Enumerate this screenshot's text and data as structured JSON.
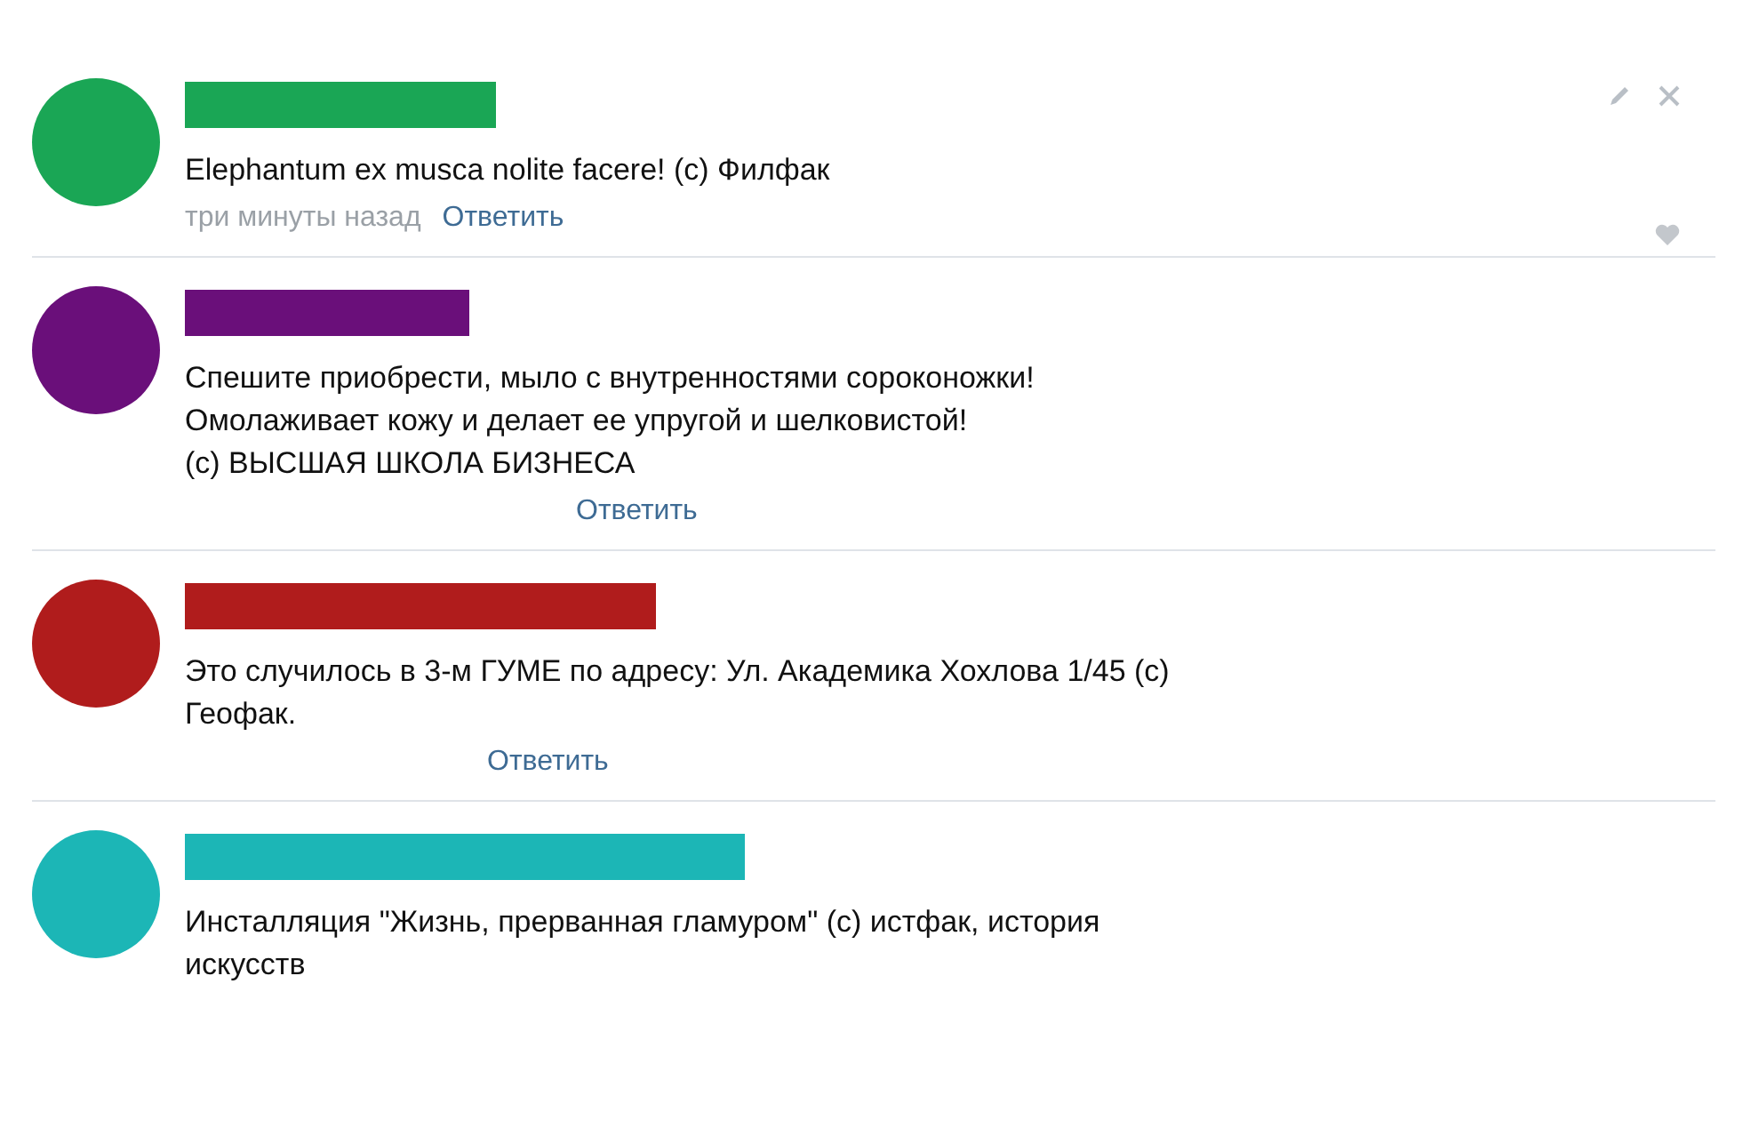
{
  "comments": [
    {
      "color": "#1aa655",
      "text": "Elephantum ex musca nolite facere! (с) Филфак",
      "time": "три минуты назад",
      "reply": "Ответить",
      "owner_actions": true
    },
    {
      "color": "#6a0f7a",
      "text": "Спешите приобрести, мыло с внутренностями сороконожки!\nОмолаживает кожу и делает ее упругой и шелковистой!\n(с) ВЫСШАЯ ШКОЛА БИЗНЕСА",
      "reply": "Ответить",
      "owner_actions": false
    },
    {
      "color": "#b01c1c",
      "text": "Это случилось в 3-м ГУМЕ по адресу: Ул. Академика Хохлова 1/45 (с)\nГеофак.",
      "reply": "Ответить",
      "owner_actions": false
    },
    {
      "color": "#1cb6b6",
      "text": "Инсталляция \"Жизнь, прерванная гламуром\" (с) истфак, история\nискусств",
      "owner_actions": false
    }
  ]
}
